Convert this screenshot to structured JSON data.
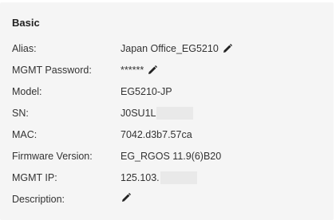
{
  "section": {
    "title": "Basic"
  },
  "fields": {
    "alias": {
      "label": "Alias:",
      "value": "Japan Office_EG5210"
    },
    "mgmt_password": {
      "label": "MGMT Password:",
      "value": "******"
    },
    "model": {
      "label": "Model:",
      "value": "EG5210-JP"
    },
    "sn": {
      "label": "SN:",
      "value": "J0SU1L"
    },
    "mac": {
      "label": "MAC:",
      "value": "7042.d3b7.57ca"
    },
    "firmware": {
      "label": "Firmware Version:",
      "value": "EG_RGOS 11.9(6)B20"
    },
    "mgmt_ip": {
      "label": "MGMT IP:",
      "value": "125.103."
    },
    "description": {
      "label": "Description:",
      "value": ""
    }
  },
  "icons": {
    "edit": "pencil-icon"
  },
  "colors": {
    "panel_bg": "#f5f5f5",
    "text": "#333333",
    "mask": "#e9e9e9"
  }
}
